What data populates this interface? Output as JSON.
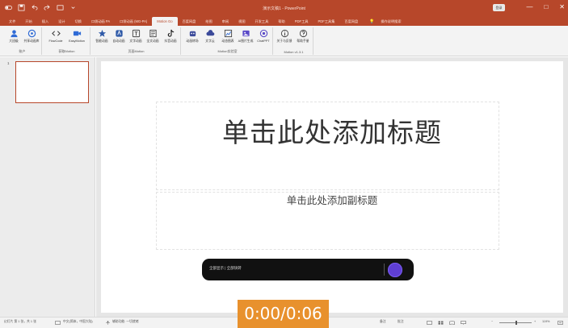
{
  "window": {
    "title": "演示文稿1 - PowerPoint",
    "user_button": "登录",
    "controls": [
      "—",
      "□",
      "✕"
    ]
  },
  "tabs": [
    "文件",
    "开始",
    "插入",
    "设计",
    "切换",
    "口袋动画 PA",
    "口袋动画 (MG-PA)",
    "Motion Go",
    "百度网盘",
    "绘图",
    "审阅",
    "视图",
    "开发工具",
    "帮助",
    "PDF工具",
    "PDF工具集",
    "百度网盘"
  ],
  "tabs_active_index": 7,
  "tell_me": "操作说明搜索",
  "ribbon": {
    "groups": [
      {
        "label": "账户",
        "buttons": [
          "大班级",
          "共享动画库"
        ]
      },
      {
        "label": "获取Motion",
        "buttons": [
          "FlowCode",
          "EasyMotion"
        ]
      },
      {
        "label": "页面Motion",
        "buttons": [
          "智能动画",
          "自动动画",
          "文字动画",
          "全文动画",
          "抖音动画"
        ]
      },
      {
        "label": "Motion实验室",
        "buttons": [
          "动画转场",
          "文字云",
          "动态图表",
          "AI图片生成",
          "ChatPPT"
        ]
      },
      {
        "label": "Motion v1.3.1",
        "buttons": [
          "关于与反馈",
          "帮助手册"
        ]
      }
    ]
  },
  "thumbnails": [
    {
      "number": "1"
    }
  ],
  "slide": {
    "title_placeholder": "单击此处添加标题",
    "subtitle_placeholder": "单击此处添加副标题"
  },
  "recorder": {
    "hint": "全部显示 | 全部快转"
  },
  "statusbar": {
    "slide_info": "幻灯片 第 1 张，共 1 张",
    "language": "中文(简体，中国大陆)",
    "accessibility": "辅助功能: 一切就绪",
    "notes": "备注",
    "comments": "批注",
    "zoom": "119%"
  },
  "timer": "0:00/0:06",
  "colors": {
    "brand": "#b7472a",
    "recorder_button": "#5f3fd3",
    "timer_bg": "#e8912d"
  }
}
